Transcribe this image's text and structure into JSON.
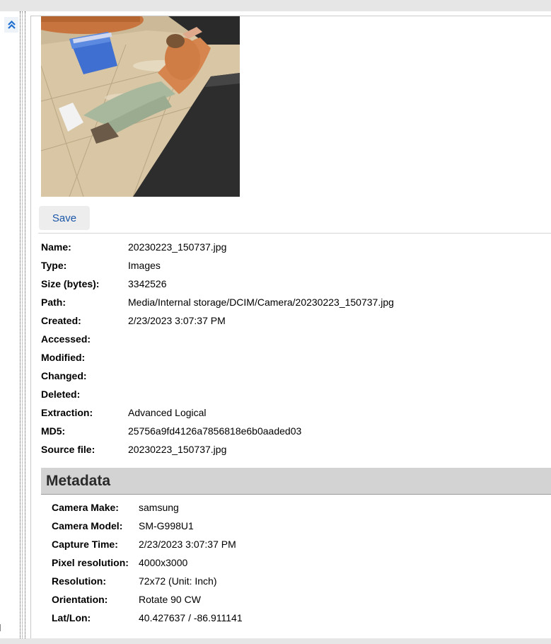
{
  "photo": {
    "subject": "person lying on tiled floor"
  },
  "save_label": "Save",
  "collapse_icon": "chevron-double-up-icon",
  "properties": [
    {
      "label": "Name:",
      "value": "20230223_150737.jpg"
    },
    {
      "label": "Type:",
      "value": "Images"
    },
    {
      "label": "Size (bytes):",
      "value": "3342526"
    },
    {
      "label": "Path:",
      "value": "Media/Internal storage/DCIM/Camera/20230223_150737.jpg"
    },
    {
      "label": "Created:",
      "value": "2/23/2023 3:07:37 PM"
    },
    {
      "label": "Accessed:",
      "value": ""
    },
    {
      "label": "Modified:",
      "value": ""
    },
    {
      "label": "Changed:",
      "value": ""
    },
    {
      "label": "Deleted:",
      "value": ""
    },
    {
      "label": "Extraction:",
      "value": "Advanced Logical"
    },
    {
      "label": "MD5:",
      "value": "25756a9fd4126a7856818e6b0aaded03"
    },
    {
      "label": "Source file:",
      "value": "20230223_150737.jpg"
    }
  ],
  "metadata": {
    "title": "Metadata",
    "items": [
      {
        "label": "Camera Make:",
        "value": "samsung"
      },
      {
        "label": "Camera Model:",
        "value": "SM-G998U1"
      },
      {
        "label": "Capture Time:",
        "value": "2/23/2023 3:07:37 PM"
      },
      {
        "label": "Pixel resolution:",
        "value": "4000x3000"
      },
      {
        "label": "Resolution:",
        "value": "72x72 (Unit: Inch)"
      },
      {
        "label": "Orientation:",
        "value": "Rotate 90 CW"
      },
      {
        "label": "Lat/Lon:",
        "value": "40.427637 / -86.911141"
      }
    ]
  }
}
